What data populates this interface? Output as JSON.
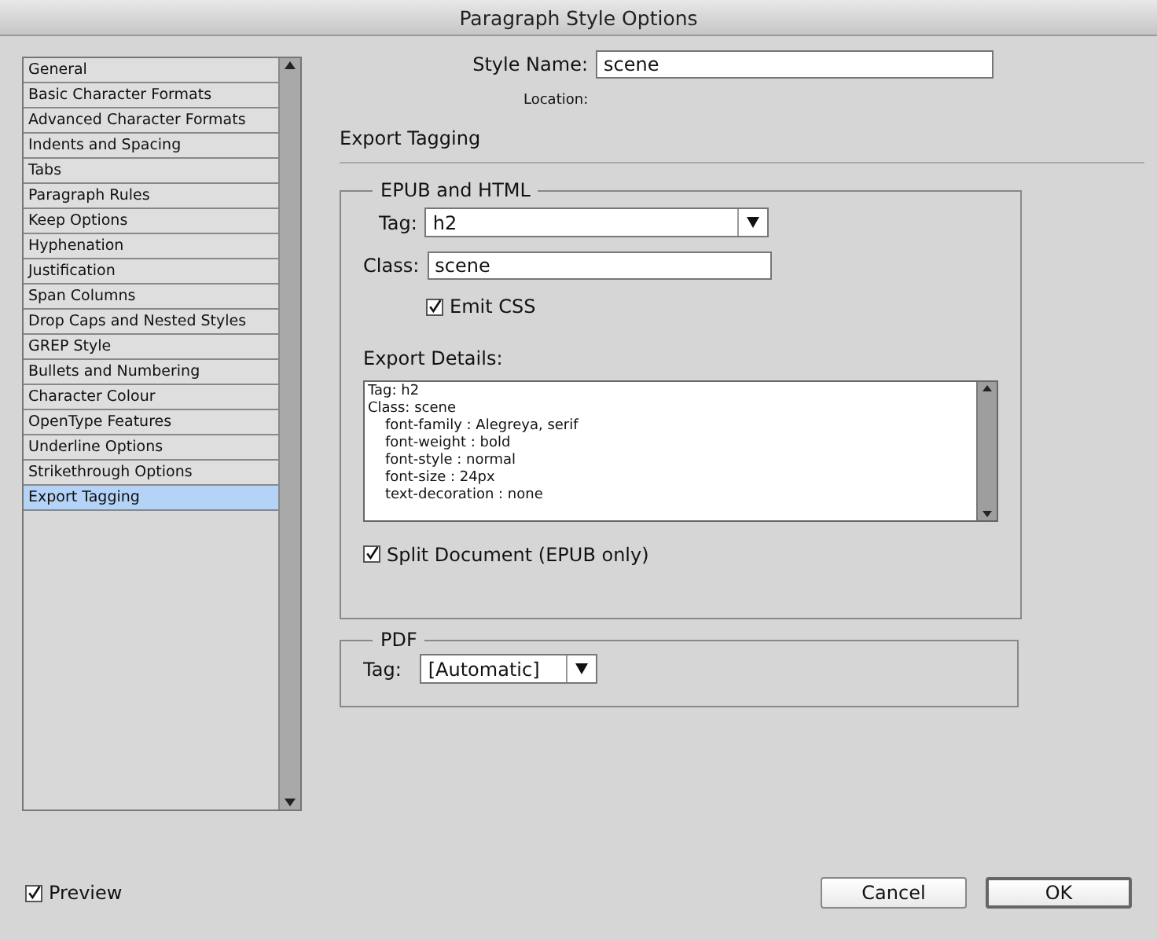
{
  "window": {
    "title": "Paragraph Style Options"
  },
  "sidebar": {
    "items": [
      {
        "label": "General",
        "selected": false
      },
      {
        "label": "Basic Character Formats",
        "selected": false
      },
      {
        "label": "Advanced Character Formats",
        "selected": false
      },
      {
        "label": "Indents and Spacing",
        "selected": false
      },
      {
        "label": "Tabs",
        "selected": false
      },
      {
        "label": "Paragraph Rules",
        "selected": false
      },
      {
        "label": "Keep Options",
        "selected": false
      },
      {
        "label": "Hyphenation",
        "selected": false
      },
      {
        "label": "Justification",
        "selected": false
      },
      {
        "label": "Span Columns",
        "selected": false
      },
      {
        "label": "Drop Caps and Nested Styles",
        "selected": false
      },
      {
        "label": "GREP Style",
        "selected": false
      },
      {
        "label": "Bullets and Numbering",
        "selected": false
      },
      {
        "label": "Character Colour",
        "selected": false
      },
      {
        "label": "OpenType Features",
        "selected": false
      },
      {
        "label": "Underline Options",
        "selected": false
      },
      {
        "label": "Strikethrough Options",
        "selected": false
      },
      {
        "label": "Export Tagging",
        "selected": true
      }
    ]
  },
  "style_name": {
    "label": "Style Name:",
    "value": "scene"
  },
  "location": {
    "label": "Location:"
  },
  "section_title": "Export Tagging",
  "epub_html": {
    "title": "EPUB and HTML",
    "tag": {
      "label": "Tag:",
      "value": "h2"
    },
    "class": {
      "label": "Class:",
      "value": "scene"
    },
    "emit_css": {
      "label": "Emit CSS",
      "checked": true
    },
    "export_details": {
      "label": "Export Details:",
      "lines": [
        {
          "text": "Tag: h2",
          "indented": false
        },
        {
          "text": "Class: scene",
          "indented": false
        },
        {
          "text": "font-family : Alegreya, serif",
          "indented": true
        },
        {
          "text": "font-weight : bold",
          "indented": true
        },
        {
          "text": "font-style : normal",
          "indented": true
        },
        {
          "text": "font-size : 24px",
          "indented": true
        },
        {
          "text": "text-decoration : none",
          "indented": true
        }
      ]
    },
    "split_document": {
      "label": "Split Document (EPUB only)",
      "checked": true
    }
  },
  "pdf": {
    "title": "PDF",
    "tag": {
      "label": "Tag:",
      "value": "[Automatic]"
    }
  },
  "preview": {
    "label": "Preview",
    "checked": true
  },
  "buttons": [
    {
      "label": "Cancel",
      "default": false
    },
    {
      "label": "OK",
      "default": true
    }
  ]
}
